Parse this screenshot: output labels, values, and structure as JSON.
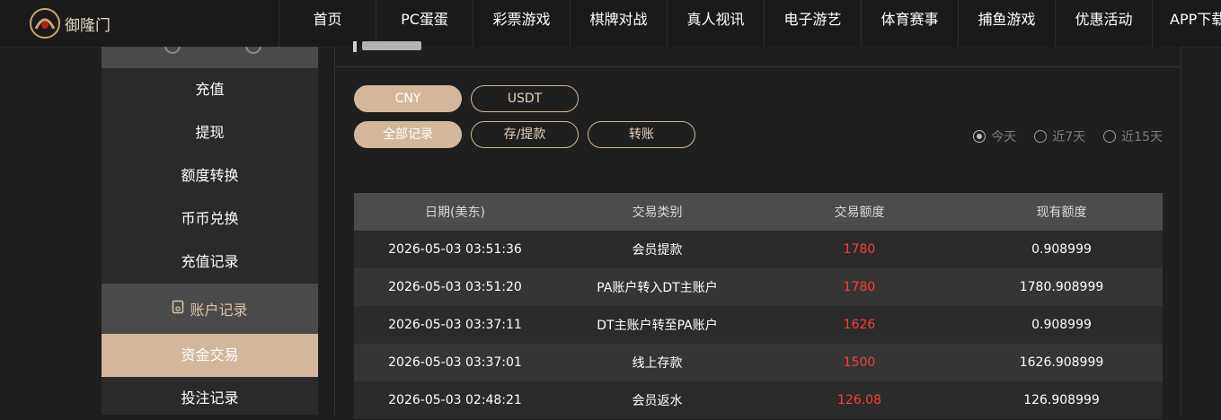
{
  "nav": {
    "items": [
      {
        "label": "首页"
      },
      {
        "label": "PC蛋蛋"
      },
      {
        "label": "彩票游戏"
      },
      {
        "label": "棋牌对战"
      },
      {
        "label": "真人视讯"
      },
      {
        "label": "电子游艺"
      },
      {
        "label": "体育赛事"
      },
      {
        "label": "捕鱼游戏"
      },
      {
        "label": "优惠活动"
      },
      {
        "label": "APP下载"
      }
    ]
  },
  "logo": {
    "text": "御隆门"
  },
  "sidebar": {
    "items": [
      {
        "label": "充值"
      },
      {
        "label": "提现"
      },
      {
        "label": "额度转换"
      },
      {
        "label": "币币兑换"
      },
      {
        "label": "充值记录"
      }
    ],
    "section_label": "账户记录",
    "active_item": "资金交易",
    "next_item": "投注记录"
  },
  "currency_tabs": [
    "CNY",
    "USDT"
  ],
  "record_tabs": [
    "全部记录",
    "存/提款",
    "转账"
  ],
  "date_filters": [
    {
      "label": "今天",
      "selected": true
    },
    {
      "label": "近7天",
      "selected": false
    },
    {
      "label": "近15天",
      "selected": false
    }
  ],
  "table": {
    "headers": [
      "日期(美东)",
      "交易类别",
      "交易额度",
      "现有额度"
    ],
    "rows": [
      {
        "date": "2026-05-03 03:51:36",
        "type": "会员提款",
        "amount": "1780",
        "balance": "0.908999"
      },
      {
        "date": "2026-05-03 03:51:20",
        "type": "PA账户转入DT主账户",
        "amount": "1780",
        "balance": "1780.908999"
      },
      {
        "date": "2026-05-03 03:37:11",
        "type": "DT主账户转至PA账户",
        "amount": "1626",
        "balance": "0.908999"
      },
      {
        "date": "2026-05-03 03:37:01",
        "type": "线上存款",
        "amount": "1500",
        "balance": "1626.908999"
      },
      {
        "date": "2026-05-03 02:48:21",
        "type": "会员返水",
        "amount": "126.08",
        "balance": "126.908999"
      }
    ]
  },
  "colors": {
    "accent": "#d4b79a",
    "amount": "#ff3b3b",
    "header_bg": "#4c4c4c"
  }
}
